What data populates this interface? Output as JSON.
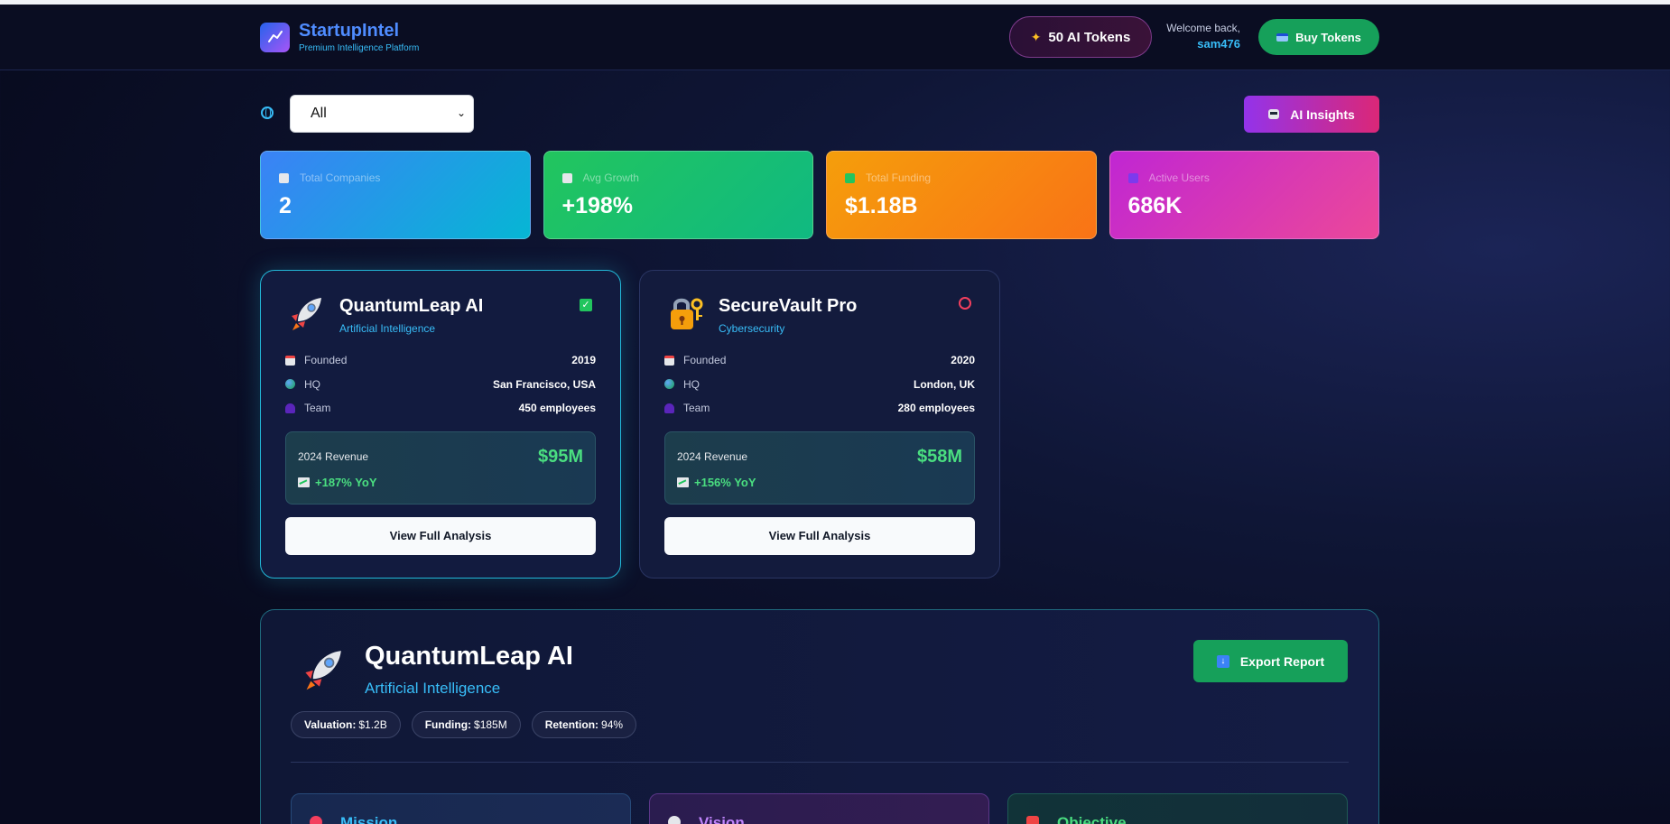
{
  "header": {
    "brand_name": "StartupIntel",
    "brand_sub": "Premium Intelligence Platform",
    "tokens": "50 AI Tokens",
    "welcome": "Welcome back,",
    "username": "sam476",
    "buy_label": "Buy Tokens"
  },
  "toolbar": {
    "filter_value": "All",
    "insights_label": "AI Insights"
  },
  "stats": [
    {
      "label": "Total Companies",
      "value": "2"
    },
    {
      "label": "Avg Growth",
      "value": "+198%"
    },
    {
      "label": "Total Funding",
      "value": "$1.18B"
    },
    {
      "label": "Active Users",
      "value": "686K"
    }
  ],
  "companies": [
    {
      "name": "QuantumLeap AI",
      "category": "Artificial Intelligence",
      "founded_label": "Founded",
      "founded": "2019",
      "hq_label": "HQ",
      "hq": "San Francisco, USA",
      "team_label": "Team",
      "team": "450 employees",
      "revenue_label": "2024 Revenue",
      "revenue": "$95M",
      "yoy": "+187% YoY",
      "button": "View Full Analysis"
    },
    {
      "name": "SecureVault Pro",
      "category": "Cybersecurity",
      "founded_label": "Founded",
      "founded": "2020",
      "hq_label": "HQ",
      "hq": "London, UK",
      "team_label": "Team",
      "team": "280 employees",
      "revenue_label": "2024 Revenue",
      "revenue": "$58M",
      "yoy": "+156% YoY",
      "button": "View Full Analysis"
    }
  ],
  "detail": {
    "name": "QuantumLeap AI",
    "category": "Artificial Intelligence",
    "export_label": "Export Report",
    "chips": [
      {
        "k": "Valuation:",
        "v": "$1.2B"
      },
      {
        "k": "Funding:",
        "v": "$185M"
      },
      {
        "k": "Retention:",
        "v": "94%"
      }
    ],
    "pillars": {
      "mission": "Mission",
      "vision": "Vision",
      "objective": "Objective"
    }
  },
  "colors": {
    "accent_blue": "#4f8cff",
    "accent_cyan": "#38bdf8",
    "success_green": "#4ade80",
    "button_green": "#16a05a"
  }
}
